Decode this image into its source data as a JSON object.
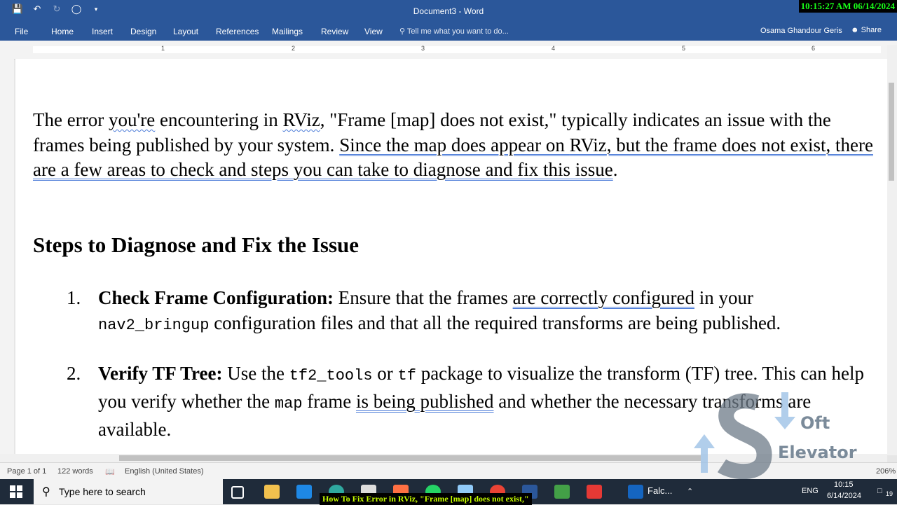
{
  "window": {
    "doc_title": "Document3 - Word",
    "timestamp": "10:15:27 AM 06/14/2024"
  },
  "ribbon": {
    "tabs": [
      "File",
      "Home",
      "Insert",
      "Design",
      "Layout",
      "References",
      "Mailings",
      "Review",
      "View"
    ],
    "tell_me": "Tell me what you want to do...",
    "user": "Osama Ghandour Geris",
    "share": "Share"
  },
  "ruler": {
    "numbers": [
      "1",
      "2",
      "3",
      "4",
      "5",
      "6"
    ]
  },
  "document": {
    "paragraph": {
      "s1": "The error ",
      "s2": "you're",
      "s3": " encountering in ",
      "s4": "RViz",
      "s5": ", \"Frame [map] does not exist,\" typically indicates an issue with the frames being published by your system. ",
      "s6": "Since the map does appear on ",
      "s7": "RViz",
      "s8": ", but the frame does not exist, there are a few areas to check and steps you can take to diagnose and fix this issue",
      "s9": "."
    },
    "heading": "Steps to Diagnose and Fix the Issue",
    "items": [
      {
        "number": "1.",
        "bold": "Check Frame Configuration:",
        "t1": " Ensure that the frames ",
        "t2": "are correctly configured",
        "t3": " in your ",
        "code1": "nav2_bringup",
        "t4": " configuration files and that all the required transforms are being published."
      },
      {
        "number": "2.",
        "bold": "Verify TF Tree:",
        "t1": " Use the ",
        "code1": "tf2_tools",
        "t2": " or ",
        "code2": "tf",
        "t3": " package to visualize the transform (TF) tree. This can help you verify whether the ",
        "code3": "map",
        "t4": " frame ",
        "t5": "is being published",
        "t6": " and whether the necessary transforms are available."
      }
    ]
  },
  "status_bar": {
    "page": "Page 1 of 1",
    "words": "122 words",
    "language": "English (United States)",
    "zoom": "206%"
  },
  "taskbar": {
    "search_placeholder": "Type here to search",
    "active_app": "Falc...",
    "language": "ENG",
    "time": "10:15",
    "date": "6/14/2024",
    "notification_count": "19"
  },
  "video_caption": "How To Fix Error in RViz, \"Frame [map] does not exist,\"",
  "watermark": {
    "line1": "Oft",
    "line2": "Elevator"
  },
  "colors": {
    "word_blue": "#2b579a",
    "taskbar": "#1f2b3a",
    "timestamp_green": "#19ff19"
  }
}
